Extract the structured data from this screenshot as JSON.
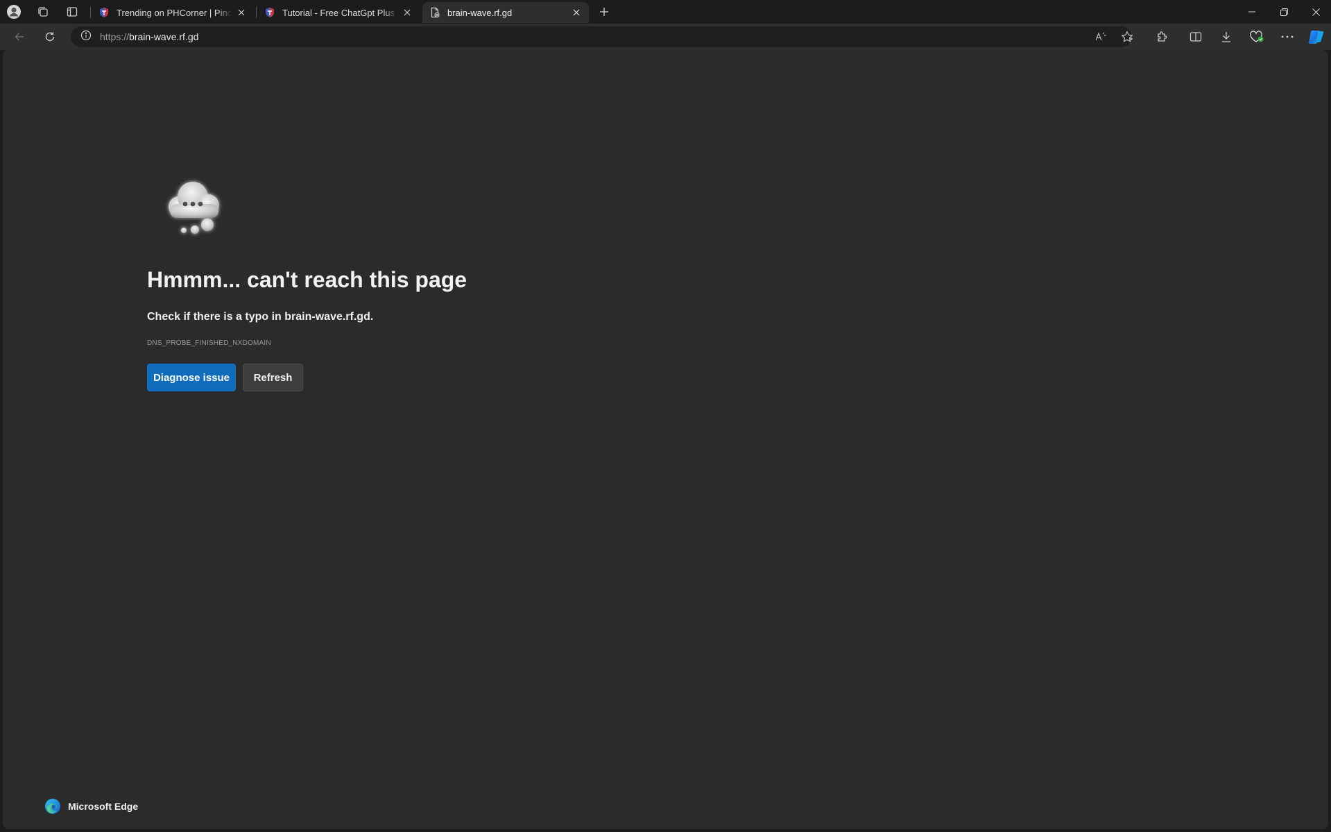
{
  "tabs": [
    {
      "title": "Trending on PHCorner | Pinoy Internet",
      "active": false,
      "favicon": "phcorner-shield-icon"
    },
    {
      "title": "Tutorial - Free ChatGpt Plus Brain",
      "active": false,
      "favicon": "phcorner-shield-icon"
    },
    {
      "title": "brain-wave.rf.gd",
      "active": true,
      "favicon": "broken-page-icon"
    }
  ],
  "address_bar": {
    "scheme": "https://",
    "host": "brain-wave.rf.gd"
  },
  "error_page": {
    "heading": "Hmmm... can't reach this page",
    "message": "Check if there is a typo in brain-wave.rf.gd.",
    "error_code": "DNS_PROBE_FINISHED_NXDOMAIN",
    "diagnose_label": "Diagnose issue",
    "refresh_label": "Refresh"
  },
  "footer": {
    "brand_name": "Microsoft Edge"
  },
  "colors": {
    "accent": "#0f6cbd",
    "page_bg": "#2b2b2b",
    "frame_bg": "#1c1c1c"
  }
}
